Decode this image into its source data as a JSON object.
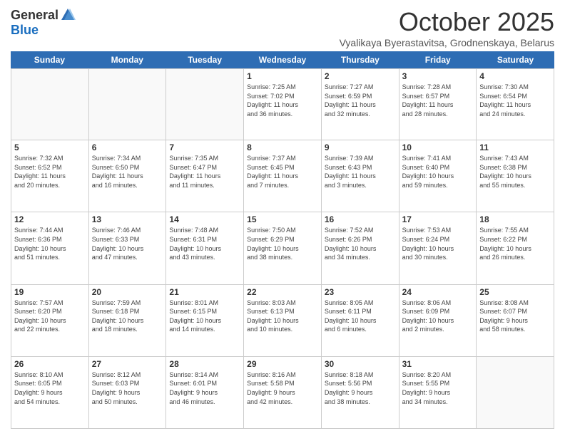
{
  "logo": {
    "general": "General",
    "blue": "Blue"
  },
  "title": "October 2025",
  "subtitle": "Vyalikaya Byerastavitsa, Grodnenskaya, Belarus",
  "days": [
    "Sunday",
    "Monday",
    "Tuesday",
    "Wednesday",
    "Thursday",
    "Friday",
    "Saturday"
  ],
  "rows": [
    [
      {
        "day": "",
        "info": ""
      },
      {
        "day": "",
        "info": ""
      },
      {
        "day": "",
        "info": ""
      },
      {
        "day": "1",
        "info": "Sunrise: 7:25 AM\nSunset: 7:02 PM\nDaylight: 11 hours\nand 36 minutes."
      },
      {
        "day": "2",
        "info": "Sunrise: 7:27 AM\nSunset: 6:59 PM\nDaylight: 11 hours\nand 32 minutes."
      },
      {
        "day": "3",
        "info": "Sunrise: 7:28 AM\nSunset: 6:57 PM\nDaylight: 11 hours\nand 28 minutes."
      },
      {
        "day": "4",
        "info": "Sunrise: 7:30 AM\nSunset: 6:54 PM\nDaylight: 11 hours\nand 24 minutes."
      }
    ],
    [
      {
        "day": "5",
        "info": "Sunrise: 7:32 AM\nSunset: 6:52 PM\nDaylight: 11 hours\nand 20 minutes."
      },
      {
        "day": "6",
        "info": "Sunrise: 7:34 AM\nSunset: 6:50 PM\nDaylight: 11 hours\nand 16 minutes."
      },
      {
        "day": "7",
        "info": "Sunrise: 7:35 AM\nSunset: 6:47 PM\nDaylight: 11 hours\nand 11 minutes."
      },
      {
        "day": "8",
        "info": "Sunrise: 7:37 AM\nSunset: 6:45 PM\nDaylight: 11 hours\nand 7 minutes."
      },
      {
        "day": "9",
        "info": "Sunrise: 7:39 AM\nSunset: 6:43 PM\nDaylight: 11 hours\nand 3 minutes."
      },
      {
        "day": "10",
        "info": "Sunrise: 7:41 AM\nSunset: 6:40 PM\nDaylight: 10 hours\nand 59 minutes."
      },
      {
        "day": "11",
        "info": "Sunrise: 7:43 AM\nSunset: 6:38 PM\nDaylight: 10 hours\nand 55 minutes."
      }
    ],
    [
      {
        "day": "12",
        "info": "Sunrise: 7:44 AM\nSunset: 6:36 PM\nDaylight: 10 hours\nand 51 minutes."
      },
      {
        "day": "13",
        "info": "Sunrise: 7:46 AM\nSunset: 6:33 PM\nDaylight: 10 hours\nand 47 minutes."
      },
      {
        "day": "14",
        "info": "Sunrise: 7:48 AM\nSunset: 6:31 PM\nDaylight: 10 hours\nand 43 minutes."
      },
      {
        "day": "15",
        "info": "Sunrise: 7:50 AM\nSunset: 6:29 PM\nDaylight: 10 hours\nand 38 minutes."
      },
      {
        "day": "16",
        "info": "Sunrise: 7:52 AM\nSunset: 6:26 PM\nDaylight: 10 hours\nand 34 minutes."
      },
      {
        "day": "17",
        "info": "Sunrise: 7:53 AM\nSunset: 6:24 PM\nDaylight: 10 hours\nand 30 minutes."
      },
      {
        "day": "18",
        "info": "Sunrise: 7:55 AM\nSunset: 6:22 PM\nDaylight: 10 hours\nand 26 minutes."
      }
    ],
    [
      {
        "day": "19",
        "info": "Sunrise: 7:57 AM\nSunset: 6:20 PM\nDaylight: 10 hours\nand 22 minutes."
      },
      {
        "day": "20",
        "info": "Sunrise: 7:59 AM\nSunset: 6:18 PM\nDaylight: 10 hours\nand 18 minutes."
      },
      {
        "day": "21",
        "info": "Sunrise: 8:01 AM\nSunset: 6:15 PM\nDaylight: 10 hours\nand 14 minutes."
      },
      {
        "day": "22",
        "info": "Sunrise: 8:03 AM\nSunset: 6:13 PM\nDaylight: 10 hours\nand 10 minutes."
      },
      {
        "day": "23",
        "info": "Sunrise: 8:05 AM\nSunset: 6:11 PM\nDaylight: 10 hours\nand 6 minutes."
      },
      {
        "day": "24",
        "info": "Sunrise: 8:06 AM\nSunset: 6:09 PM\nDaylight: 10 hours\nand 2 minutes."
      },
      {
        "day": "25",
        "info": "Sunrise: 8:08 AM\nSunset: 6:07 PM\nDaylight: 9 hours\nand 58 minutes."
      }
    ],
    [
      {
        "day": "26",
        "info": "Sunrise: 8:10 AM\nSunset: 6:05 PM\nDaylight: 9 hours\nand 54 minutes."
      },
      {
        "day": "27",
        "info": "Sunrise: 8:12 AM\nSunset: 6:03 PM\nDaylight: 9 hours\nand 50 minutes."
      },
      {
        "day": "28",
        "info": "Sunrise: 8:14 AM\nSunset: 6:01 PM\nDaylight: 9 hours\nand 46 minutes."
      },
      {
        "day": "29",
        "info": "Sunrise: 8:16 AM\nSunset: 5:58 PM\nDaylight: 9 hours\nand 42 minutes."
      },
      {
        "day": "30",
        "info": "Sunrise: 8:18 AM\nSunset: 5:56 PM\nDaylight: 9 hours\nand 38 minutes."
      },
      {
        "day": "31",
        "info": "Sunrise: 8:20 AM\nSunset: 5:55 PM\nDaylight: 9 hours\nand 34 minutes."
      },
      {
        "day": "",
        "info": ""
      }
    ]
  ]
}
